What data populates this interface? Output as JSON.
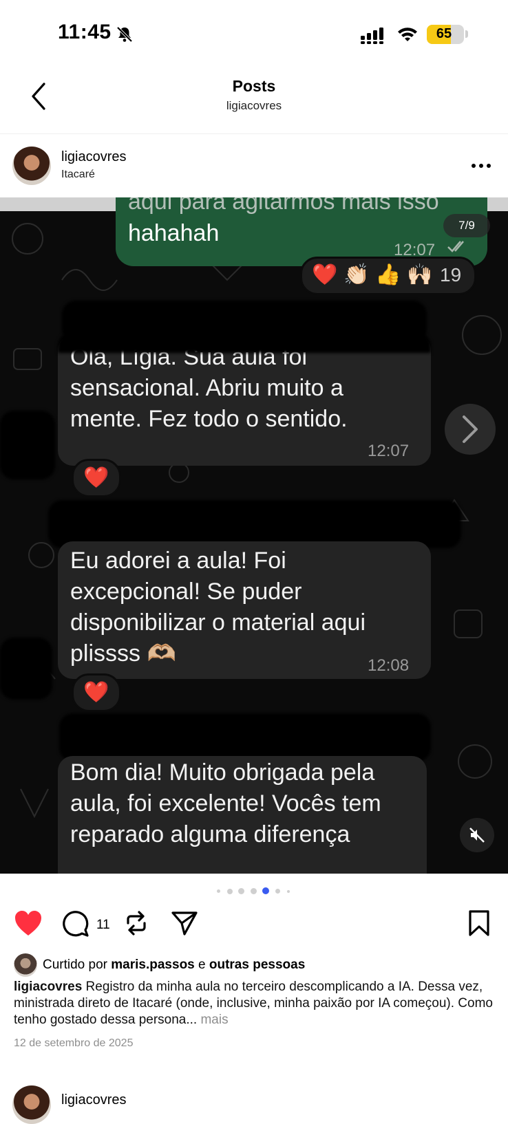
{
  "status_bar": {
    "time": "11:45",
    "battery": "65",
    "battery_level": 0.65
  },
  "header": {
    "title": "Posts",
    "subtitle": "ligiacovres"
  },
  "post": {
    "username": "ligiacovres",
    "location": "Itacaré",
    "media": {
      "carousel_counter": "7/9",
      "messages": [
        {
          "direction": "out",
          "text_partial": "aqui para agitarmos mais isso",
          "text": "hahahah",
          "time": "12:07"
        },
        {
          "direction": "in",
          "lines": [
            "Olá, Lígia. Sua aula foi",
            "sensacional. Abriu muito a",
            "mente. Fez todo o sentido."
          ],
          "time": "12:07"
        },
        {
          "direction": "in",
          "lines": [
            "Eu adorei a aula! Foi",
            "excepcional! Se puder",
            "disponibilizar o material aqui",
            "plissss 🫶🏼"
          ],
          "time": "12:08"
        },
        {
          "direction": "in",
          "lines": [
            "Bom dia! Muito obrigada pela",
            "aula, foi excelente! Vocês tem",
            "reparado alguma diferença"
          ]
        }
      ],
      "reactions": {
        "emojis": [
          "❤️",
          "👏🏻",
          "👍",
          "🙌🏻"
        ],
        "count": "19"
      },
      "heart_reaction": "❤️"
    },
    "carousel": {
      "total": 6,
      "active_index": 3
    },
    "actions": {
      "comments_count": "11"
    },
    "liked_by": {
      "prefix": "Curtido por ",
      "user": "maris.passos",
      "conj": " e ",
      "others": "outras pessoas"
    },
    "caption": {
      "user": "ligiacovres",
      "text": " Registro da minha aula no terceiro descomplicando a IA. Dessa vez, ministrada direto de Itacaré (onde, inclusive, minha paixão por IA começou). Como tenho gostado dessa persona...",
      "more": " mais"
    },
    "date": "12 de setembro de 2025",
    "next_post_username": "ligiacovres"
  },
  "colors": {
    "like_red": "#ff3040",
    "active_dot": "#3a5bf0",
    "outgoing_bubble": "#1f5a38",
    "incoming_bubble": "#242424"
  },
  "icons": [
    "bell-slash-icon",
    "signal-icon",
    "wifi-icon",
    "chevron-left-icon",
    "more-icon",
    "heart-icon",
    "comment-icon",
    "repost-icon",
    "send-icon",
    "bookmark-icon",
    "mute-icon",
    "chevron-right-icon"
  ]
}
